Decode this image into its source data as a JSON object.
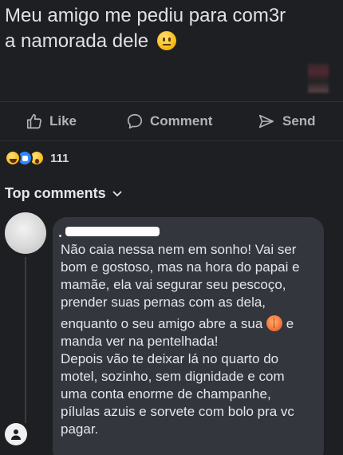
{
  "post": {
    "text_line1": "Meu amigo me pediu para com3r",
    "text_line2": "a namorada dele"
  },
  "actions": {
    "like_label": "Like",
    "comment_label": "Comment",
    "send_label": "Send"
  },
  "reactions": {
    "count": "111",
    "icons": [
      "haha-reaction-icon",
      "like-reaction-icon",
      "wow-reaction-icon"
    ]
  },
  "comments_header": {
    "label": "Top comments"
  },
  "comment": {
    "lines": [
      "Não caia nessa nem em sonho! Vai ser",
      "bom e gostoso, mas na hora do papai e",
      "mamãe, ela vai segurar seu pescoço,",
      "prender suas pernas com as dela,",
      "enquanto o seu amigo abre a sua",
      "e",
      "manda ver na pentelhada!",
      "Depois vão te deixar lá no quarto do",
      "motel, sozinho, sem dignidade e com",
      "uma conta enorme de champanhe,",
      "pílulas azuis e sorvete com bolo pra vc",
      "pagar."
    ]
  },
  "colors": {
    "background": "#1e1f23",
    "bubble": "#33363c",
    "muted_text": "#b0b3b8",
    "like_blue": "#2d88ff"
  }
}
